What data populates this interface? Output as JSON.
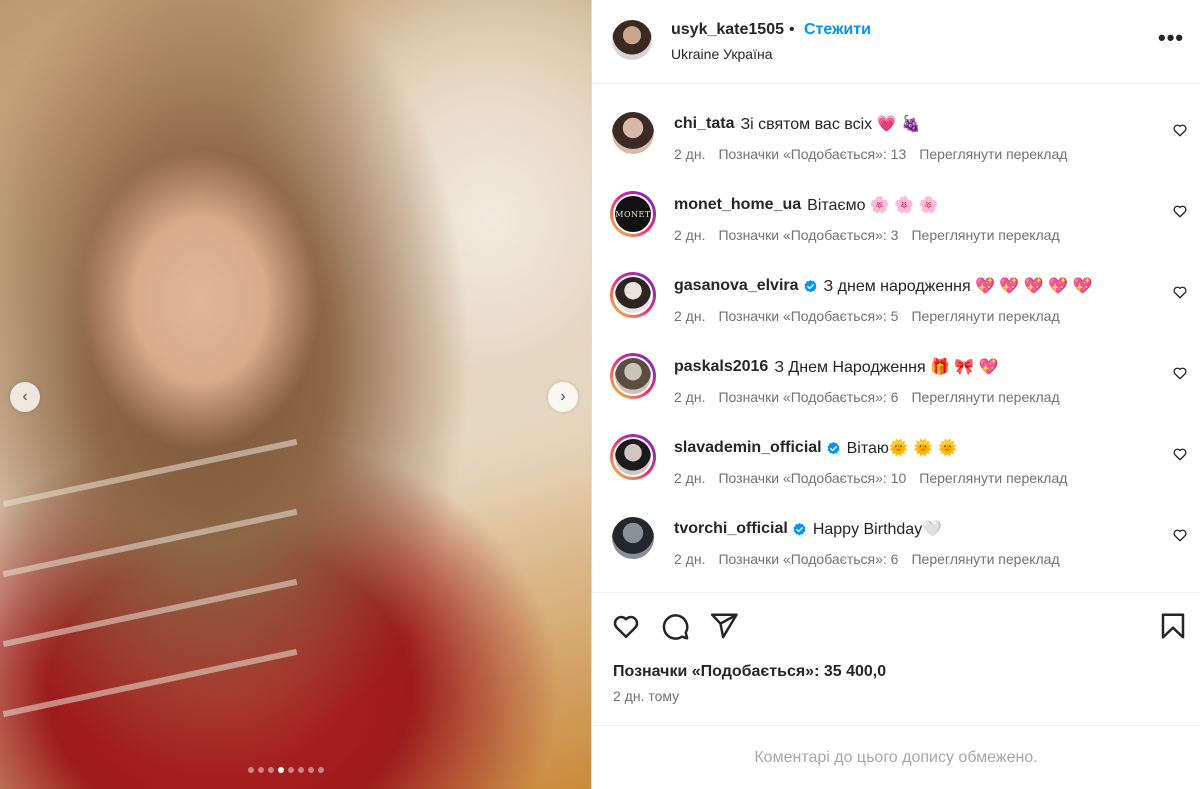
{
  "post": {
    "username": "usyk_kate1505",
    "separator": "•",
    "follow_label": "Стежити",
    "location": "Ukraine Україна",
    "more_label": "•••"
  },
  "media": {
    "prev_glyph": "‹",
    "next_glyph": "›",
    "slide_count": 8,
    "active_slide": 3
  },
  "comments": [
    {
      "username": "chi_tata",
      "verified": false,
      "text": "Зі святом вас всіх 💗 🍇",
      "time": "2 дн.",
      "likes": "Позначки «Подобається»: 13",
      "translate": "Переглянути переклад",
      "avatar_colors": [
        "#d8b8a8",
        "#3b2a24"
      ],
      "ring": false
    },
    {
      "username": "monet_home_ua",
      "verified": false,
      "text": "Вітаємо 🌸 🌸 🌸",
      "time": "2 дн.",
      "likes": "Позначки «Подобається»: 3",
      "translate": "Переглянути переклад",
      "avatar_colors": [
        "#111111",
        "#111111"
      ],
      "ring": true,
      "avatar_text": "MONET"
    },
    {
      "username": "gasanova_elvira",
      "verified": true,
      "text": "З днем народження 💖 💖 💖 💖 💖",
      "time": "2 дн.",
      "likes": "Позначки «Подобається»: 5",
      "translate": "Переглянути переклад",
      "avatar_colors": [
        "#e9e4e0",
        "#2c2522"
      ],
      "ring": true
    },
    {
      "username": "paskals2016",
      "verified": false,
      "text": "З Днем Народження 🎁 🎀 💖",
      "time": "2 дн.",
      "likes": "Позначки «Подобається»: 6",
      "translate": "Переглянути переклад",
      "avatar_colors": [
        "#c9c3ba",
        "#5a4d42"
      ],
      "ring": true
    },
    {
      "username": "slavademin_official",
      "verified": true,
      "text": "Вітаю🌞 🌞 🌞",
      "time": "2 дн.",
      "likes": "Позначки «Подобається»: 10",
      "translate": "Переглянути переклад",
      "avatar_colors": [
        "#cfc7c2",
        "#1b1b1b"
      ],
      "ring": true
    },
    {
      "username": "tvorchi_official",
      "verified": true,
      "text": "Happy Birthday🤍",
      "time": "2 дн.",
      "likes": "Позначки «Подобається»: 6",
      "translate": "Переглянути переклад",
      "avatar_colors": [
        "#8a8f96",
        "#23262b"
      ],
      "ring": false
    }
  ],
  "actions": {
    "like_icon": "heart-icon",
    "comment_icon": "comment-icon",
    "share_icon": "share-icon",
    "save_icon": "bookmark-icon",
    "likes_text": "Позначки «Подобається»: 35 400,0",
    "posted_when": "2 дн. тому"
  },
  "limited_text": "Коментарі до цього допису обмежено.",
  "colors": {
    "link": "#0095f6",
    "muted": "#737373",
    "text": "#262626",
    "border": "#dbdbdb"
  }
}
